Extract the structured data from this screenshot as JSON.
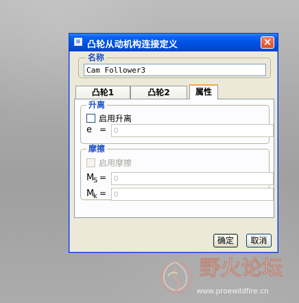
{
  "dialog": {
    "title": "凸轮从动机构连接定义"
  },
  "name_group": {
    "label": "名称",
    "value": "Cam Follower3"
  },
  "tabs": [
    {
      "label": "凸轮1"
    },
    {
      "label": "凸轮2"
    },
    {
      "label": "属性"
    }
  ],
  "liftoff": {
    "group_label": "升离",
    "enable_label": "启用升离",
    "symbol": "e",
    "equals": "=",
    "value": "0"
  },
  "friction": {
    "group_label": "摩擦",
    "enable_label": "启用摩擦",
    "mu_symbol": "M",
    "mu_s_sub": "S",
    "mu_k_sub": "k",
    "equals": "=",
    "mu_s_value": "0",
    "mu_k_value": "0"
  },
  "buttons": {
    "ok": "确定",
    "cancel": "取消"
  },
  "watermark": {
    "title": "野火论坛",
    "url": "www.proewildfire.cn"
  },
  "colors": {
    "titlebar": "#0054e3",
    "group_label": "#1e4fc8",
    "dialog_bg": "#ece9d8"
  },
  "icons": {
    "title": "window-icon",
    "close": "close-icon"
  }
}
